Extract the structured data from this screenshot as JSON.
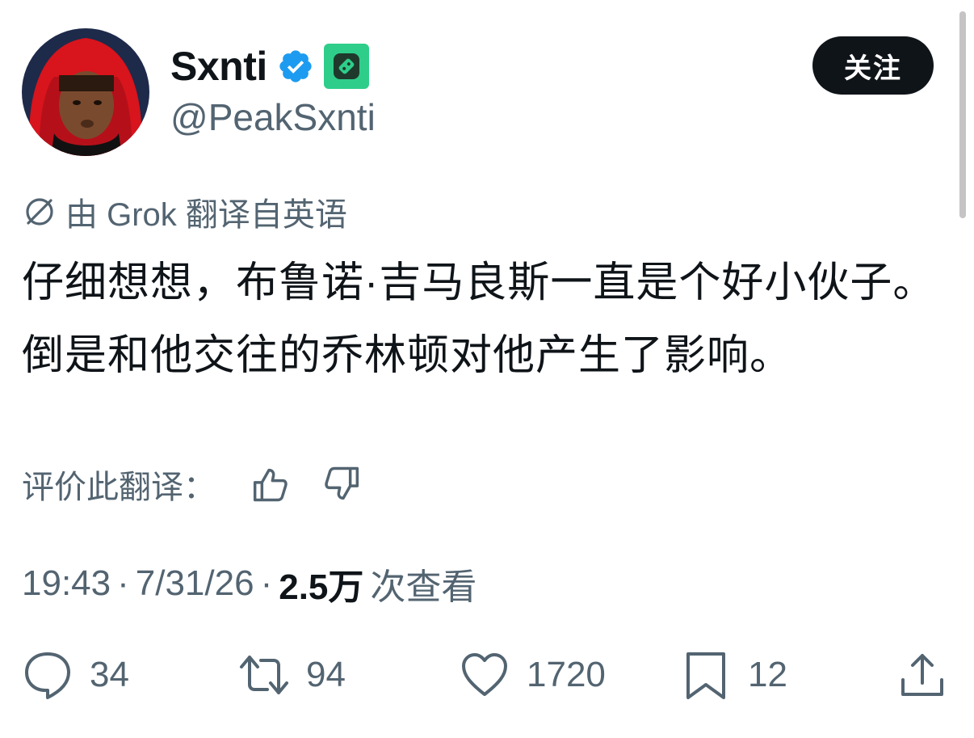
{
  "user": {
    "display_name": "Sxnti",
    "handle": "@PeakSxnti",
    "follow_label": "关注"
  },
  "translation": {
    "notice": "由 Grok 翻译自英语",
    "rate_label": "评价此翻译："
  },
  "tweet": {
    "text": "仔细想想，布鲁诺·吉马良斯一直是个好小伙子。倒是和他交往的乔林顿对他产生了影响。"
  },
  "meta": {
    "time": "19:43",
    "date": "7/31/26",
    "views_count": "2.5万",
    "views_label": "次查看",
    "separator": "·"
  },
  "actions": {
    "replies": "34",
    "reposts": "94",
    "likes": "1720",
    "bookmarks": "12"
  },
  "colors": {
    "primary_text": "#0f1419",
    "secondary_text": "#536471",
    "verified_blue": "#1d9bf0",
    "affiliate_green": "#2ece8a"
  }
}
